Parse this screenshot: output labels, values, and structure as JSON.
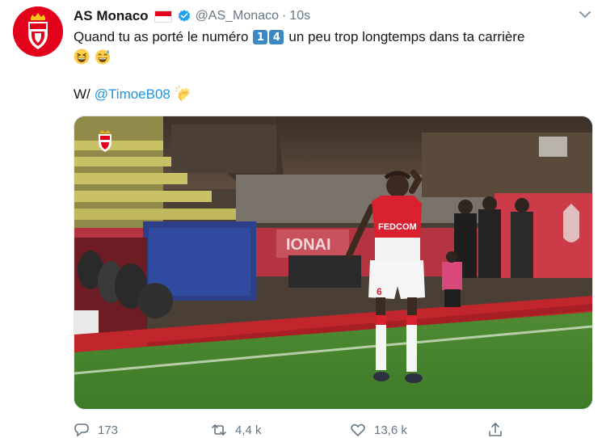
{
  "tweet": {
    "display_name": "AS Monaco",
    "handle": "@AS_Monaco",
    "separator": "·",
    "time": "10s",
    "text_part1": "Quand tu as porté le numéro",
    "keycap_1": "1",
    "keycap_2": "4",
    "text_part2": "un peu trop longtemps dans ta carrière",
    "line3_prefix": "W/",
    "mention": "@TimoeB08",
    "icons": {
      "flag": "monaco-flag-icon",
      "verified": "verified-badge-icon",
      "caret": "chevron-down-icon",
      "emoji_grin": "grinning-squinting-face-icon",
      "emoji_sweat": "grinning-face-with-sweat-icon",
      "clap": "clapping-hands-icon"
    },
    "colors": {
      "brand_red": "#e2001a",
      "link_blue": "#1b95e0",
      "muted_gray": "#657786",
      "keycap_blue": "#3b88c3"
    }
  },
  "media": {
    "kind": "video-still",
    "shirt_sponsor": "FEDCOM",
    "shirt_number": "6",
    "banner_text": "IONAI"
  },
  "actions": {
    "reply_count": "173",
    "retweet_count": "4,4 k",
    "like_count": "13,6 k"
  }
}
